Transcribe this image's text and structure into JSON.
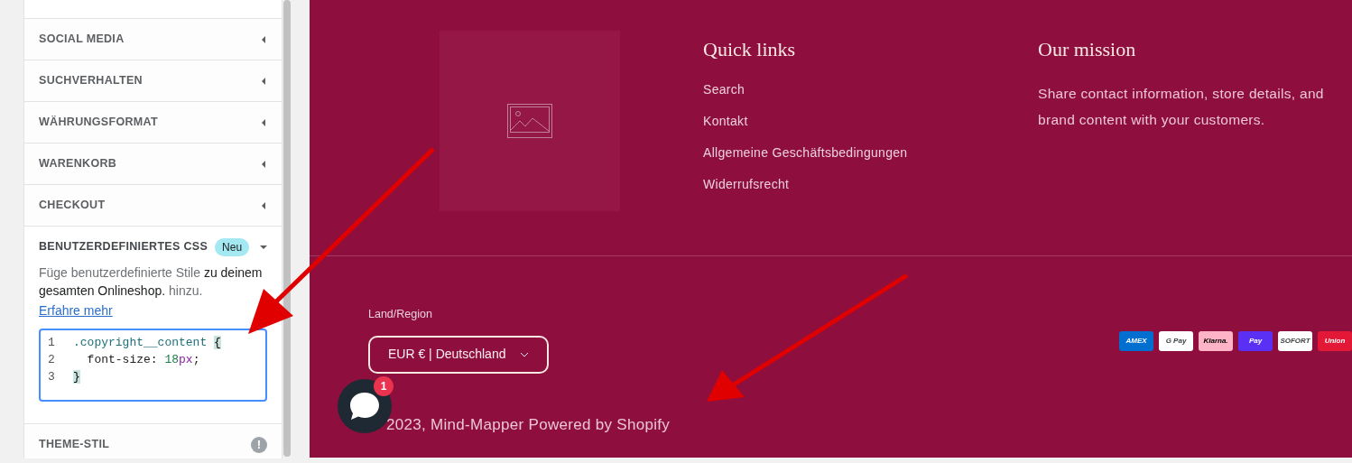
{
  "sidebar": {
    "sections": [
      {
        "title": "SOCIAL MEDIA",
        "expanded": false
      },
      {
        "title": "SUCHVERHALTEN",
        "expanded": false
      },
      {
        "title": "WÄHRUNGSFORMAT",
        "expanded": false
      },
      {
        "title": "WARENKORB",
        "expanded": false
      },
      {
        "title": "CHECKOUT",
        "expanded": false
      },
      {
        "title": "BENUTZERDEFINIERTES CSS",
        "expanded": true,
        "badge": "Neu",
        "description": "Füge benutzerdefinierte Stile **zu deinem gesamten Onlineshop.** hinzu.",
        "link": "Erfahre mehr",
        "code": [
          {
            "number": "1",
            "tokens": [
              {
                "kind": "selector",
                "text": ".copyright__content "
              },
              {
                "kind": "match",
                "text": "{"
              }
            ]
          },
          {
            "number": "2",
            "tokens": [
              {
                "kind": "plain",
                "text": "  font-size: "
              },
              {
                "kind": "number",
                "text": "18"
              },
              {
                "kind": "unit",
                "text": "px"
              },
              {
                "kind": "plain",
                "text": ";"
              }
            ]
          },
          {
            "number": "3",
            "tokens": [
              {
                "kind": "match",
                "text": "}"
              }
            ]
          }
        ]
      },
      {
        "title": "THEME-STIL",
        "expanded": false,
        "warning": "!"
      }
    ]
  },
  "footer": {
    "quick_links": {
      "heading": "Quick links",
      "links": [
        "Search",
        "Kontakt",
        "Allgemeine Geschäftsbedingungen",
        "Widerrufsrecht"
      ]
    },
    "mission": {
      "heading": "Our mission",
      "text": "Share contact information, store details, and brand content with your customers."
    },
    "region": {
      "label": "Land/Region",
      "value": "EUR € | Deutschland"
    },
    "payments": [
      {
        "label": "AMEX",
        "color": "#006fcf"
      },
      {
        "label": "G Pay",
        "color": "#ffffff"
      },
      {
        "label": "Klarna.",
        "color": "#ffb3c7"
      },
      {
        "label": "Pay",
        "color": "#5a31f4"
      },
      {
        "label": "SOFORT",
        "color": "#ffffff"
      },
      {
        "label": "Union",
        "color": "#e21836"
      }
    ],
    "copyright": "2023, Mind-Mapper Powered by Shopify"
  },
  "chat": {
    "badge": "1"
  }
}
